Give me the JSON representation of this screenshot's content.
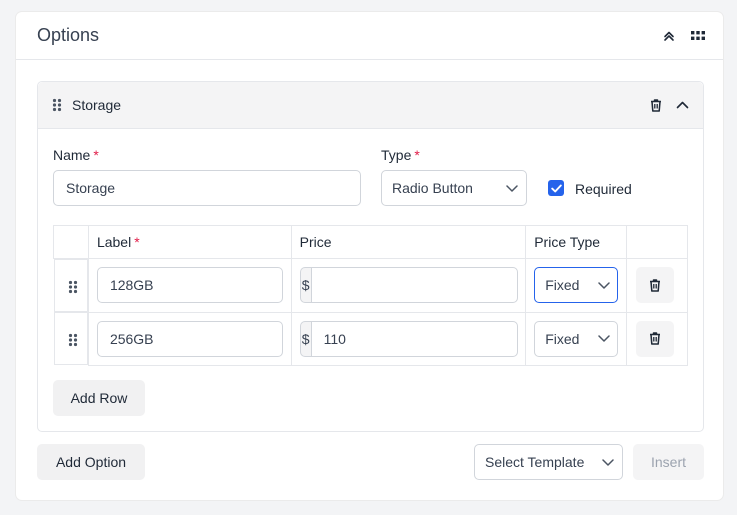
{
  "card": {
    "title": "Options"
  },
  "option": {
    "title": "Storage",
    "name_label": "Name",
    "name_value": "Storage",
    "type_label": "Type",
    "type_value": "Radio Button",
    "required_label": "Required",
    "required_checked": true
  },
  "table": {
    "headers": {
      "label": "Label",
      "price": "Price",
      "price_type": "Price Type"
    },
    "rows": [
      {
        "label": "128GB",
        "currency": "$",
        "price": "",
        "price_type": "Fixed"
      },
      {
        "label": "256GB",
        "currency": "$",
        "price": "110",
        "price_type": "Fixed"
      }
    ]
  },
  "buttons": {
    "add_row": "Add Row",
    "add_option": "Add Option",
    "select_template": "Select Template",
    "insert": "Insert"
  },
  "colors": {
    "accent": "#2563eb",
    "required_mark": "#e11d48",
    "disabled_text": "#9ca3af"
  }
}
